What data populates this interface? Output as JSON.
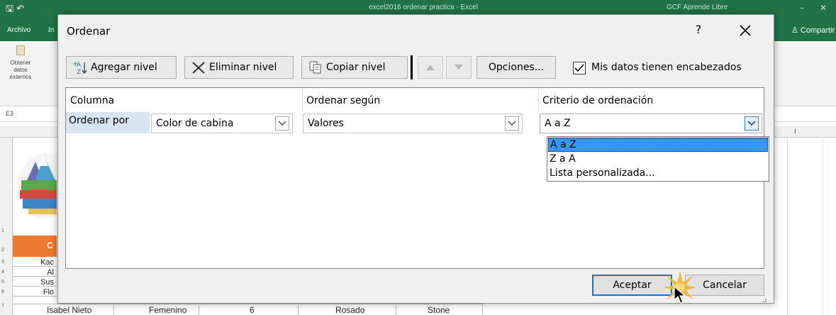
{
  "excel": {
    "title_doc": "excel2016 ordenar practica - Excel",
    "title_user": "GCF Aprende Libre",
    "tabs": [
      "Archivo",
      "In"
    ],
    "share": "Compartir",
    "ribbon_get_data": "Obtener datos externos",
    "cell_ref": "E3",
    "col_I": "I",
    "row_numbers": [
      "1",
      "2",
      "3",
      "4",
      "5",
      "6",
      "7"
    ],
    "header_cell": "C",
    "names_partial": [
      "Kac",
      "Al",
      "Sus",
      "Flo"
    ],
    "bottom_row": [
      "Isabel Nieto",
      "Femenino",
      "6",
      "Rosado",
      "Stone"
    ]
  },
  "dialog": {
    "title": "Ordenar",
    "help": "?",
    "toolbar": {
      "add_level": "Agregar nivel",
      "delete_level": "Eliminar nivel",
      "copy_level": "Copiar nivel",
      "options": "Opciones...",
      "headers_checkbox": "Mis datos tienen encabezados",
      "headers_checked": true
    },
    "columns": {
      "column": "Columna",
      "sort_on": "Ordenar según",
      "order": "Criterio de ordenación"
    },
    "row": {
      "label": "Ordenar por",
      "column_value": "Color de cabina",
      "sort_on_value": "Valores",
      "order_value": "A a Z"
    },
    "order_options": [
      "A a Z",
      "Z a A",
      "Lista personalizada..."
    ],
    "selected_option": "A a Z",
    "ok_button": "Aceptar",
    "cancel_button": "Cancelar"
  },
  "colors": {
    "excel_green": "#217346",
    "selection_blue": "#3399ff",
    "row_label_bg": "#d7e4f2",
    "default_button_border": "#0078d7",
    "burst_orange": "#f7b32b"
  }
}
